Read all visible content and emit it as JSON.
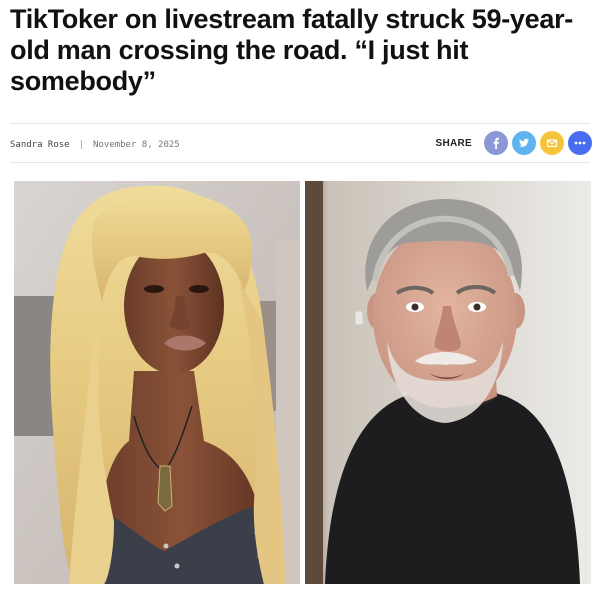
{
  "article": {
    "headline": "TikToker on livestream fatally struck 59-year-old man crossing the road. “I just hit somebody”",
    "author": "Sandra Rose",
    "separator": "|",
    "date": "November 8, 2025"
  },
  "share": {
    "label": "SHARE",
    "buttons": [
      {
        "name": "facebook",
        "icon": "facebook-icon",
        "color": "#8b98d6"
      },
      {
        "name": "twitter",
        "icon": "twitter-icon",
        "color": "#5db4ee"
      },
      {
        "name": "email",
        "icon": "mail-icon",
        "color": "#f5c43a"
      },
      {
        "name": "more",
        "icon": "more-icon",
        "color": "#4a6cf0"
      }
    ]
  },
  "images": {
    "left_alt": "woman-blonde-wig-photo",
    "right_alt": "man-gray-hair-photo"
  }
}
